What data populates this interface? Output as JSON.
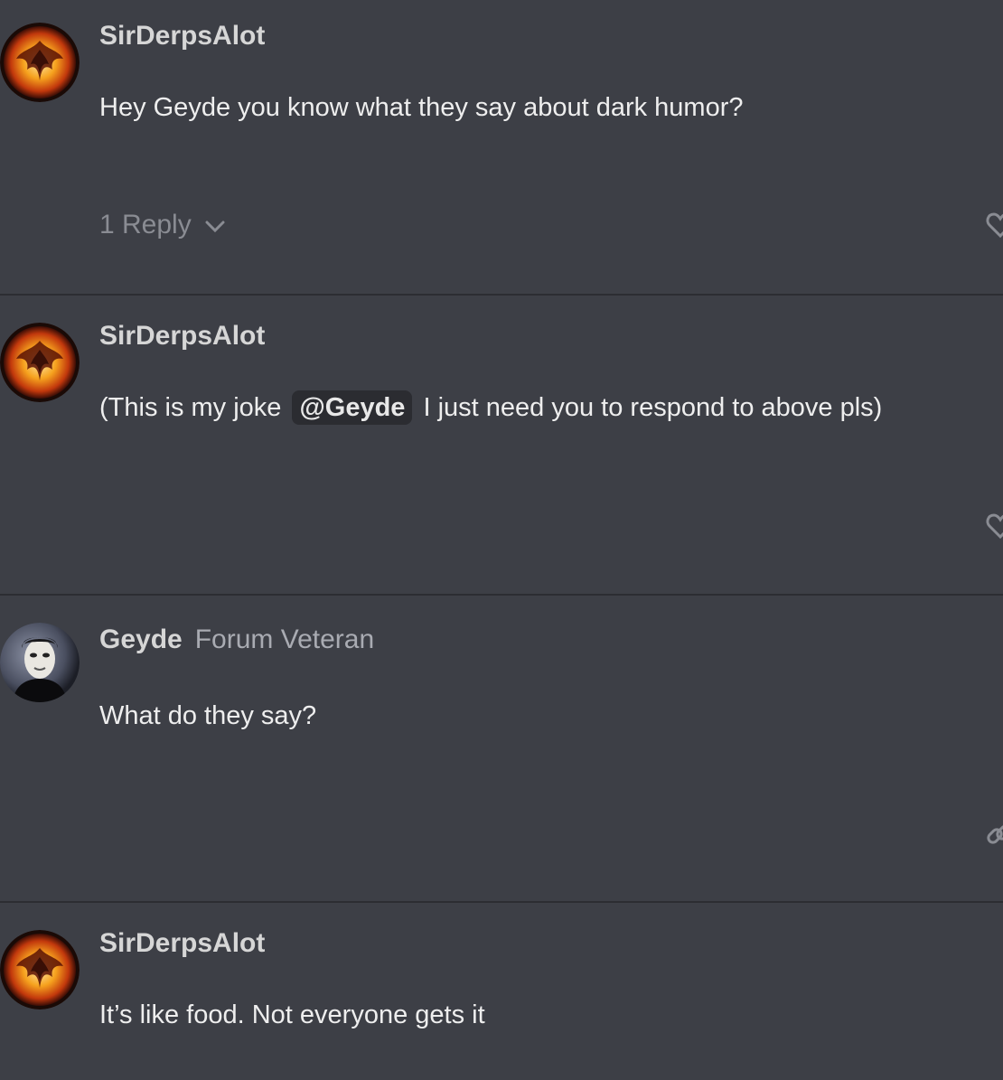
{
  "thread": {
    "posts": [
      {
        "author": "SirDerpsAlot",
        "rank": "",
        "avatar_icon": "phoenix-avatar",
        "body": "Hey Geyde you know what they say about dark humor?",
        "reply_toggle": "1 Reply",
        "side_icon": "heart-icon"
      },
      {
        "author": "SirDerpsAlot",
        "rank": "",
        "avatar_icon": "phoenix-avatar",
        "body_before": "(This is my joke",
        "mention": "@Geyde",
        "body_after": "I just need you to respond to above pls)",
        "side_icon": "heart-icon"
      },
      {
        "author": "Geyde",
        "rank": "Forum Veteran",
        "avatar_icon": "masked-face-avatar",
        "body": "What do they say?",
        "side_icon": "link-icon"
      },
      {
        "author": "SirDerpsAlot",
        "rank": "",
        "avatar_icon": "phoenix-avatar",
        "body": "It’s like food. Not everyone gets it"
      }
    ]
  },
  "colors": {
    "background": "#3d3f46",
    "divider": "#2c2d32",
    "mention_bg": "#2b2c31",
    "muted_text": "#8a8c93"
  }
}
